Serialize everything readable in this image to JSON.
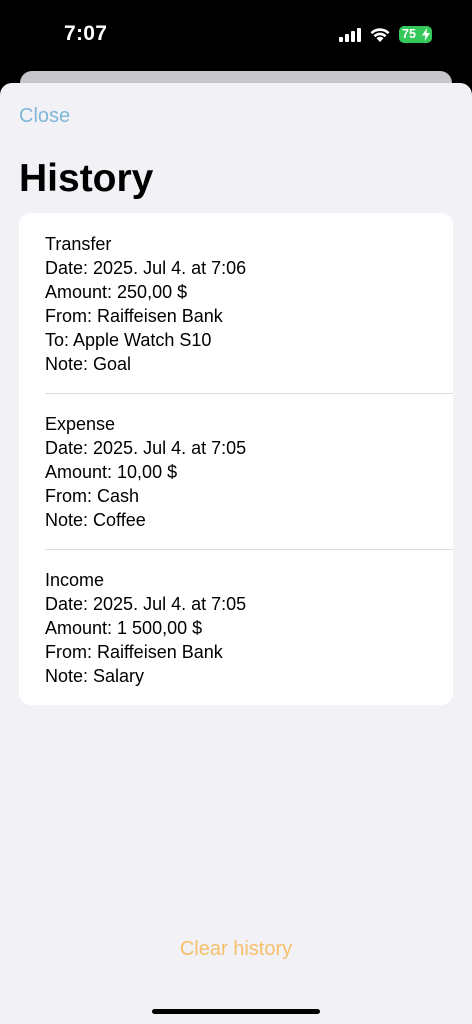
{
  "status_bar": {
    "time": "7:07",
    "battery": "75"
  },
  "header": {
    "close_label": "Close",
    "title": "History"
  },
  "history": [
    {
      "type": "Transfer",
      "date": "Date: 2025. Jul 4. at 7:06",
      "amount": "Amount: 250,00 $",
      "from": "From: Raiffeisen Bank",
      "to": "To: Apple Watch S10",
      "note": "Note: Goal"
    },
    {
      "type": "Expense",
      "date": "Date: 2025. Jul 4. at 7:05",
      "amount": "Amount: 10,00 $",
      "from": "From: Cash",
      "note": "Note: Coffee"
    },
    {
      "type": "Income",
      "date": "Date: 2025. Jul 4. at 7:05",
      "amount": "Amount: 1 500,00 $",
      "from": "From: Raiffeisen Bank",
      "note": "Note: Salary"
    }
  ],
  "footer": {
    "clear_label": "Clear history"
  },
  "colors": {
    "close": "#7fb7d9",
    "clear": "#f5c06b",
    "battery": "#34c759"
  },
  "icons": [
    "signal-icon",
    "wifi-icon",
    "battery-icon",
    "charging-bolt-icon"
  ]
}
